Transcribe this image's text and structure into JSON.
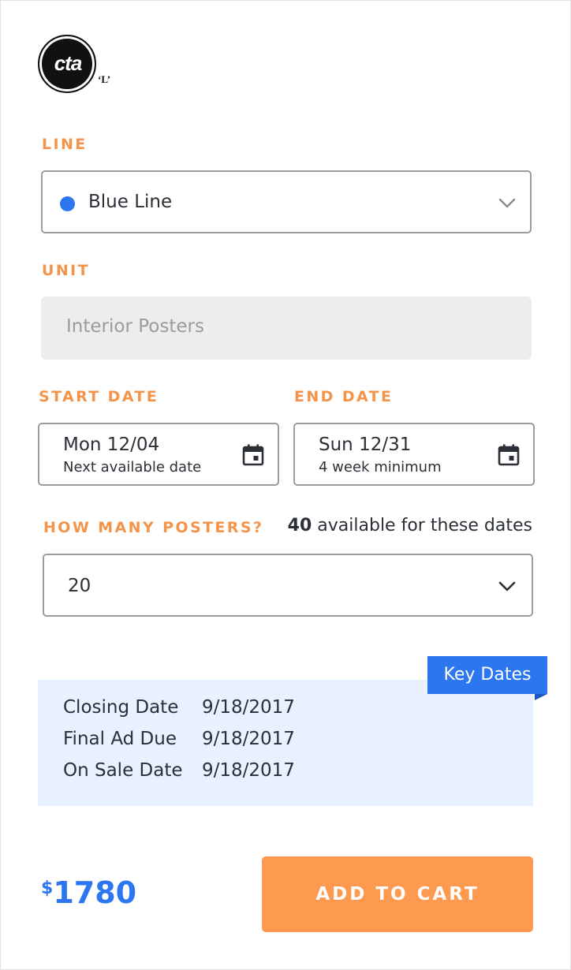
{
  "logo": {
    "text": "cta",
    "suffix": "‘L’"
  },
  "line": {
    "label": "LINE",
    "selected": "Blue Line",
    "color": "#2c77f0"
  },
  "unit": {
    "label": "UNIT",
    "placeholder": "Interior Posters"
  },
  "start_date": {
    "label": "START DATE",
    "value": "Mon 12/04",
    "hint": "Next available date"
  },
  "end_date": {
    "label": "END DATE",
    "value": "Sun 12/31",
    "hint": "4 week minimum"
  },
  "posters": {
    "label": "HOW MANY POSTERS?",
    "available_count": "40",
    "available_text": " available for these dates",
    "selected": "20"
  },
  "key_dates": {
    "tag": "Key Dates",
    "rows": [
      {
        "name": "Closing Date",
        "date": "9/18/2017"
      },
      {
        "name": "Final Ad Due",
        "date": "9/18/2017"
      },
      {
        "name": "On Sale Date",
        "date": "9/18/2017"
      }
    ]
  },
  "price": {
    "currency": "$",
    "amount": "1780"
  },
  "cart": {
    "button_label": "ADD TO CART"
  },
  "colors": {
    "accent_orange": "#f4944a",
    "button_orange": "#fd9a4f",
    "brand_blue": "#2c77f0",
    "key_dates_bg": "#e8f1ff"
  }
}
